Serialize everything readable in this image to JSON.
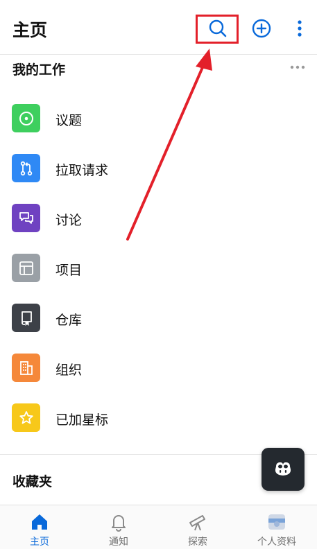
{
  "header": {
    "title": "主页",
    "actions": [
      {
        "name": "search",
        "icon": "search-icon"
      },
      {
        "name": "add",
        "icon": "plus-circle-icon"
      },
      {
        "name": "more",
        "icon": "kebab-menu-icon"
      }
    ]
  },
  "my_work": {
    "title": "我的工作",
    "items": [
      {
        "label": "议题",
        "icon": "issue-icon",
        "color": "#3ecf5e"
      },
      {
        "label": "拉取请求",
        "icon": "pull-request-icon",
        "color": "#2f89f5"
      },
      {
        "label": "讨论",
        "icon": "discussion-icon",
        "color": "#6f42c1"
      },
      {
        "label": "项目",
        "icon": "project-table-icon",
        "color": "#9aa0a6"
      },
      {
        "label": "仓库",
        "icon": "repo-icon",
        "color": "#3d4148"
      },
      {
        "label": "组织",
        "icon": "organization-icon",
        "color": "#f5883a"
      },
      {
        "label": "已加星标",
        "icon": "star-icon",
        "color": "#f7c81a"
      }
    ]
  },
  "favorites": {
    "title": "收藏夹"
  },
  "tabs": [
    {
      "label": "主页",
      "icon": "home-icon",
      "active": true
    },
    {
      "label": "通知",
      "icon": "bell-icon",
      "active": false
    },
    {
      "label": "探索",
      "icon": "telescope-icon",
      "active": false
    },
    {
      "label": "个人资料",
      "icon": "profile-icon",
      "active": false
    }
  ],
  "colors": {
    "accent": "#0969da",
    "annotation": "#e3202a"
  }
}
